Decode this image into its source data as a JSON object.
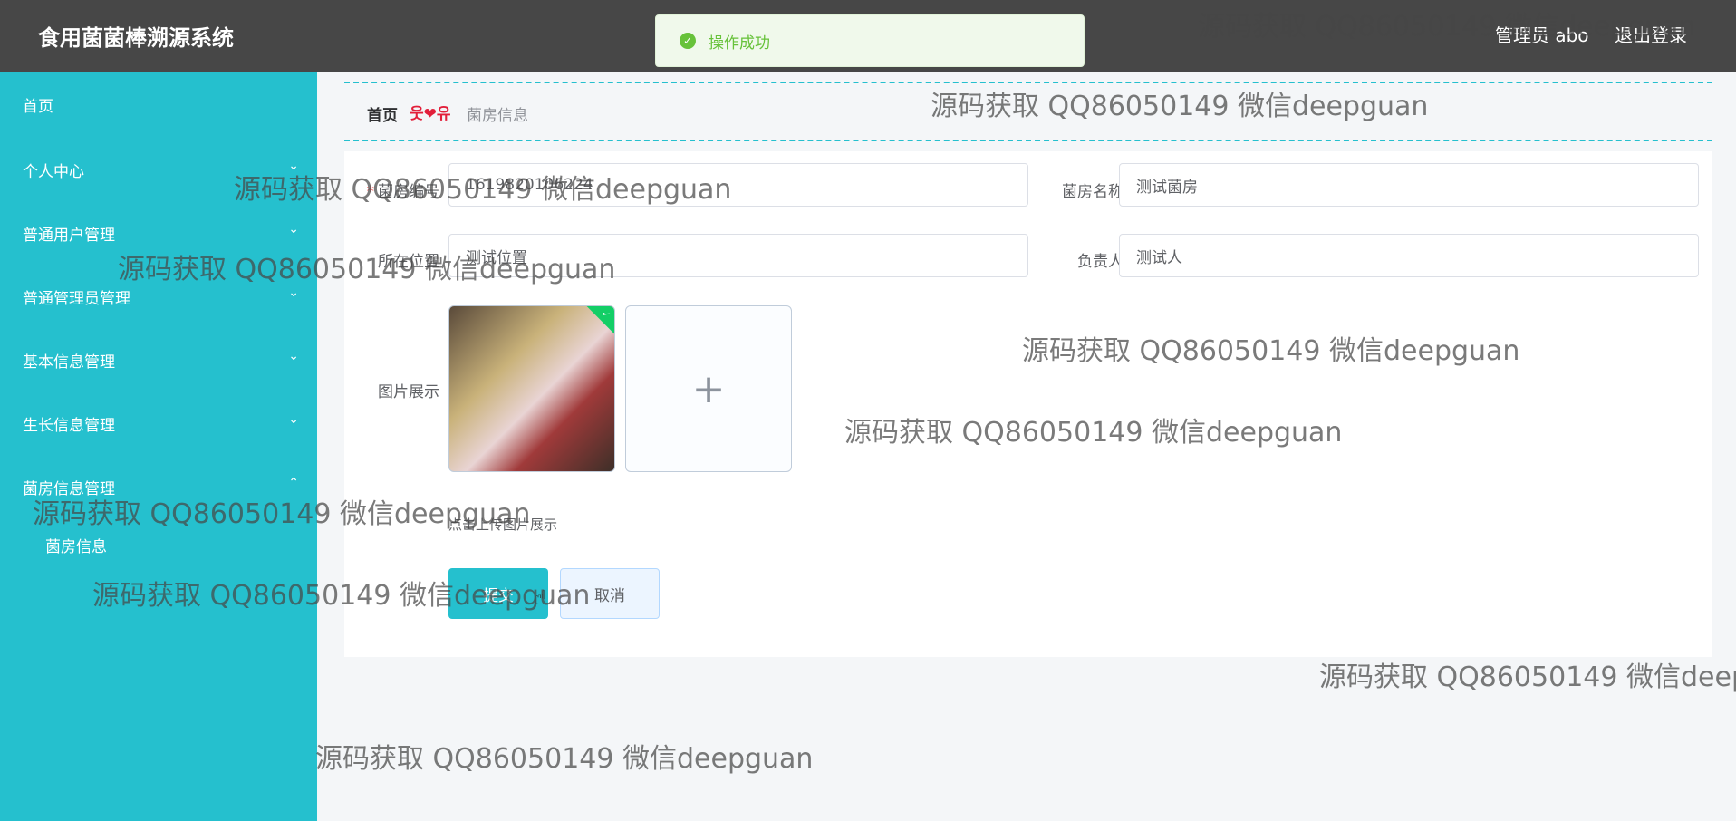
{
  "app": {
    "title": "食用菌菌棒溯源系统"
  },
  "header": {
    "user": "管理员 abo",
    "logout": "退出登录"
  },
  "toast": {
    "message": "操作成功"
  },
  "sidebar": {
    "items": [
      {
        "label": "首页"
      },
      {
        "label": "个人中心"
      },
      {
        "label": "普通用户管理"
      },
      {
        "label": "普通管理员管理"
      },
      {
        "label": "基本信息管理"
      },
      {
        "label": "生长信息管理"
      },
      {
        "label": "菌房信息管理"
      }
    ],
    "sub_items": [
      {
        "label": "菌房信息"
      }
    ]
  },
  "breadcrumb": {
    "home": "首页",
    "separator": "웃❤유",
    "current": "菌房信息"
  },
  "form": {
    "fields": {
      "room_no": {
        "label": "菌房编号",
        "value": "1619820106224"
      },
      "room_name": {
        "label": "菌房名称",
        "value": "测试菌房"
      },
      "location": {
        "label": "所在位置",
        "value": "测试位置"
      },
      "manager": {
        "label": "负责人",
        "value": "测试人"
      }
    },
    "image": {
      "label": "图片展示",
      "tip": "点击上传图片展示"
    },
    "submit": "提交",
    "cancel": "取消"
  },
  "watermark": "源码获取 QQ86050149 微信deepguan",
  "colors": {
    "accent": "#25c0ce",
    "header": "#474747",
    "success": "#67c23a"
  }
}
